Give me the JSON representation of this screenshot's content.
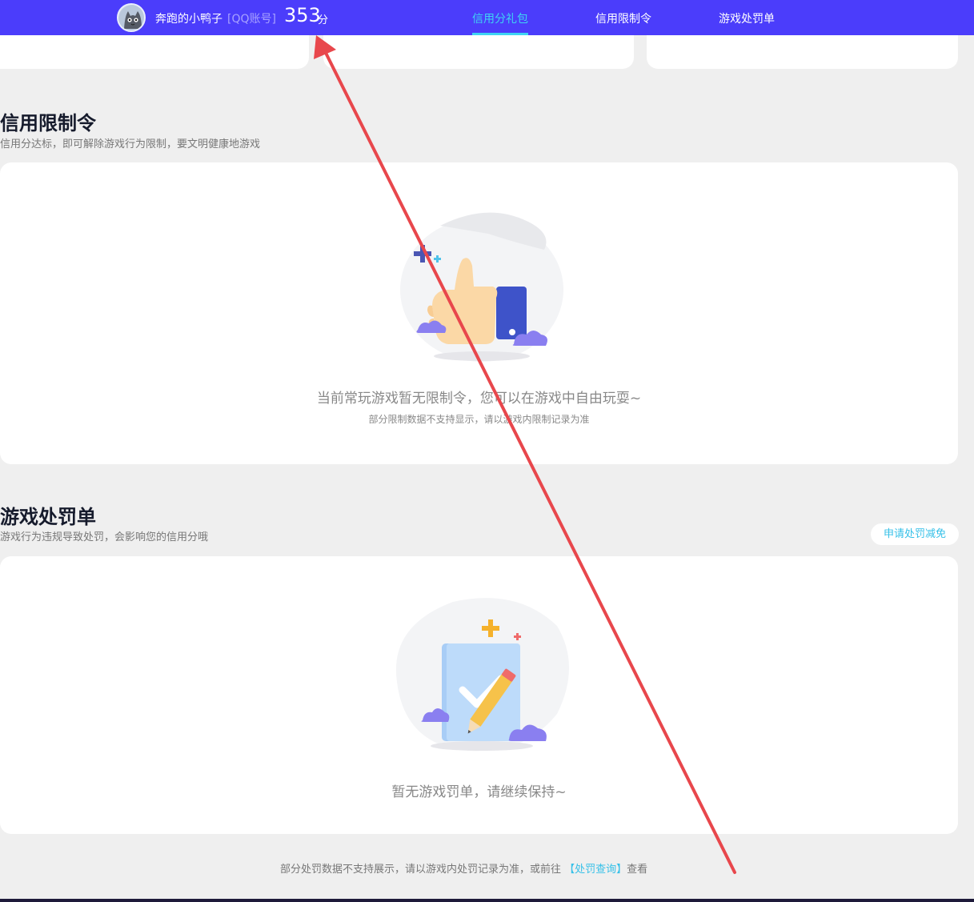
{
  "header": {
    "user_name": "奔跑的小鸭子",
    "account_type": "[QQ账号]",
    "score": "353",
    "score_unit": "分",
    "tabs": [
      {
        "label": "信用分礼包",
        "active": true
      },
      {
        "label": "信用限制令",
        "active": false
      },
      {
        "label": "游戏处罚单",
        "active": false
      }
    ]
  },
  "restriction": {
    "title": "信用限制令",
    "subtitle": "信用分达标，即可解除游戏行为限制，要文明健康地游戏",
    "empty_text": "当前常玩游戏暂无限制令，您可以在游戏中自由玩耍~",
    "note": "部分限制数据不支持显示，请以游戏内限制记录为准",
    "illustration_icon": "thumbs-up-icon"
  },
  "penalty": {
    "title": "游戏处罚单",
    "subtitle": "游戏行为违规导致处罚，会影响您的信用分哦",
    "apply_button": "申请处罚减免",
    "empty_text": "暂无游戏罚单，请继续保持~",
    "illustration_icon": "checklist-pencil-icon"
  },
  "footer": {
    "note_prefix": "部分处罚数据不支持展示，请以游戏内处罚记录为准，或前往",
    "link": "【处罚查询】",
    "note_suffix": "查看"
  },
  "colors": {
    "header_bg": "#4b3dfb",
    "accent": "#3ed4f3",
    "link": "#36c0e8",
    "annotation_arrow": "#e8474c"
  }
}
